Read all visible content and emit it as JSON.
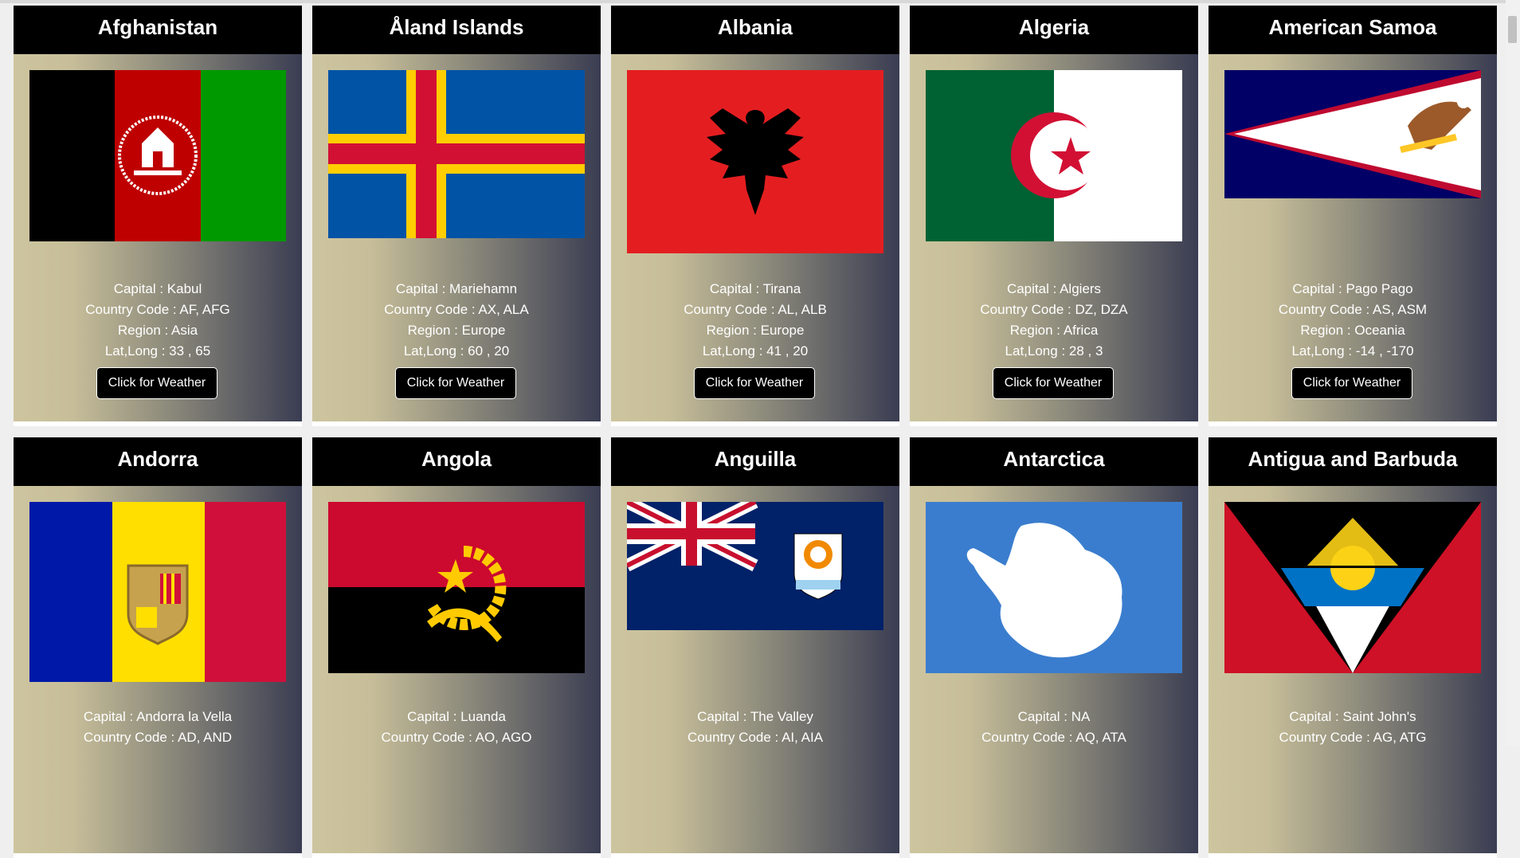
{
  "labels": {
    "capital": "Capital : ",
    "code": "Country Code : ",
    "region": "Region : ",
    "latlong": "Lat,Long : ",
    "button": "Click for Weather"
  },
  "countries": [
    {
      "name": "Afghanistan",
      "capital": "Kabul",
      "code": "AF, AFG",
      "region": "Asia",
      "latlong": "33 , 65",
      "flag_icon": "afghanistan-flag"
    },
    {
      "name": "Åland Islands",
      "capital": "Mariehamn",
      "code": "AX, ALA",
      "region": "Europe",
      "latlong": "60 , 20",
      "flag_icon": "aland-flag"
    },
    {
      "name": "Albania",
      "capital": "Tirana",
      "code": "AL, ALB",
      "region": "Europe",
      "latlong": "41 , 20",
      "flag_icon": "albania-flag"
    },
    {
      "name": "Algeria",
      "capital": "Algiers",
      "code": "DZ, DZA",
      "region": "Africa",
      "latlong": "28 , 3",
      "flag_icon": "algeria-flag"
    },
    {
      "name": "American Samoa",
      "capital": "Pago Pago",
      "code": "AS, ASM",
      "region": "Oceania",
      "latlong": "-14 , -170",
      "flag_icon": "american-samoa-flag"
    },
    {
      "name": "Andorra",
      "capital": "Andorra la Vella",
      "code": "AD, AND",
      "flag_icon": "andorra-flag"
    },
    {
      "name": "Angola",
      "capital": "Luanda",
      "code": "AO, AGO",
      "flag_icon": "angola-flag"
    },
    {
      "name": "Anguilla",
      "capital": "The Valley",
      "code": "AI, AIA",
      "flag_icon": "anguilla-flag"
    },
    {
      "name": "Antarctica",
      "capital": "NA",
      "code": "AQ, ATA",
      "flag_icon": "antarctica-flag"
    },
    {
      "name": "Antigua and Barbuda",
      "capital": "Saint John's",
      "code": "AG, ATG",
      "flag_icon": "antigua-flag"
    }
  ]
}
